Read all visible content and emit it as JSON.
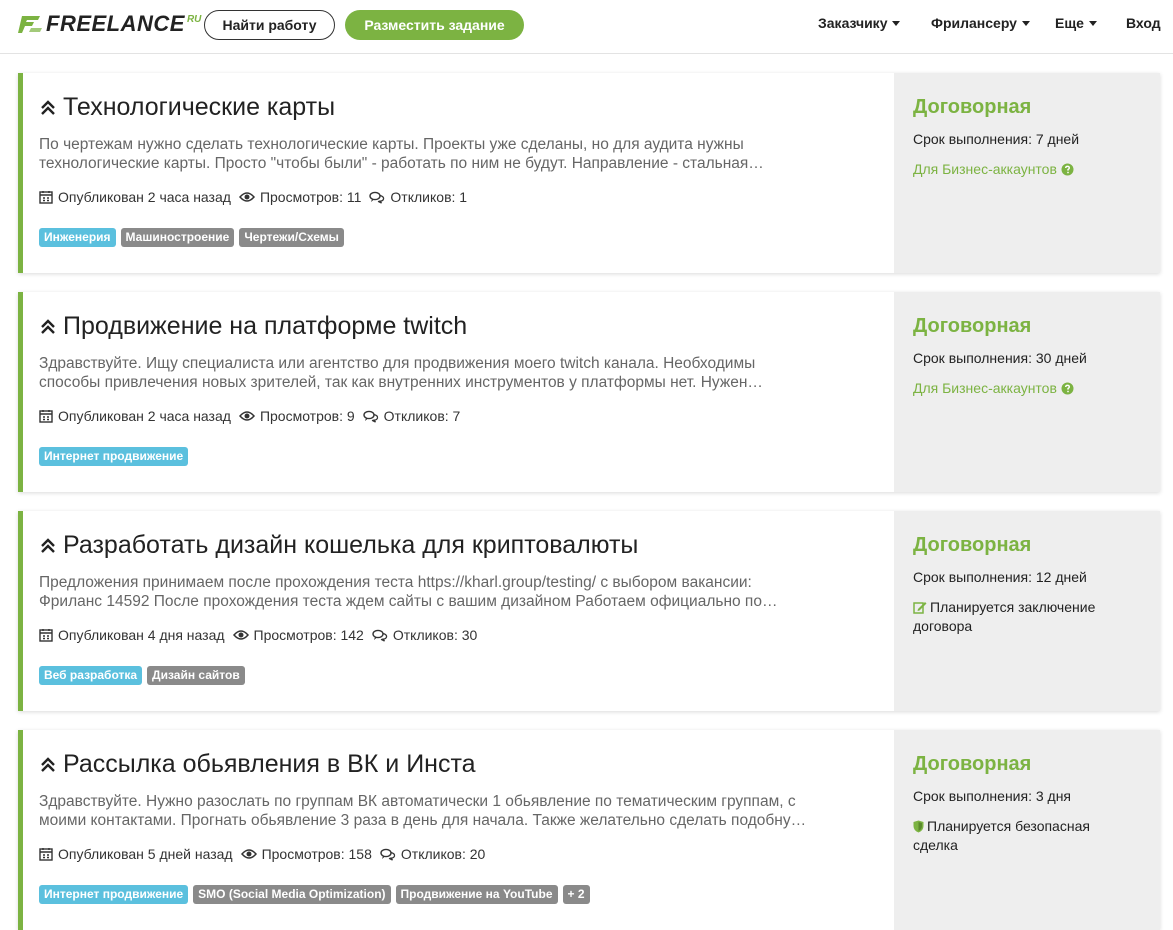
{
  "header": {
    "logo_text": "FREELANCE",
    "logo_ru": "RU",
    "find_work": "Найти работу",
    "post_task": "Разместить задание",
    "nav": [
      {
        "label": "Заказчику"
      },
      {
        "label": "Фрилансеру"
      },
      {
        "label": "Еще"
      },
      {
        "label": "Вход"
      }
    ]
  },
  "colors": {
    "brand": "#7cb342",
    "tag_blue": "#5bc0de",
    "tag_gray": "#8a8a8a"
  },
  "cards": [
    {
      "title": "Технологические карты",
      "desc1": "По чертежам нужно сделать технологические карты. Проекты уже сделаны, но для аудита нужны",
      "desc2": "технологические карты. Просто \"чтобы были\" - работать по ним не будут. Направление - стальная…",
      "published": "Опубликован 2 часа назад",
      "views": "Просмотров: 11",
      "replies": "Откликов: 1",
      "tags": [
        {
          "label": "Инженерия",
          "color": "blue"
        },
        {
          "label": "Машиностроение",
          "color": "gray"
        },
        {
          "label": "Чертежи/Схемы",
          "color": "gray"
        }
      ],
      "price": "Договорная",
      "deadline": "Срок выполнения: 7 дней",
      "biz": "Для Бизнес-аккаунтов"
    },
    {
      "title": "Продвижение на платформе twitch",
      "desc1": "Здравствуйте. Ищу специалиста или агентство для продвижения моего twitch канала. Необходимы",
      "desc2": "способы привлечения новых зрителей, так как внутренних инструментов у платформы нет. Нужен…",
      "published": "Опубликован 2 часа назад",
      "views": "Просмотров: 9",
      "replies": "Откликов: 7",
      "tags": [
        {
          "label": "Интернет продвижение",
          "color": "blue"
        }
      ],
      "price": "Договорная",
      "deadline": "Срок выполнения: 30 дней",
      "biz": "Для Бизнес-аккаунтов"
    },
    {
      "title": "Разработать дизайн кошелька для криптовалюты",
      "desc1": "Предложения принимаем после прохождения теста https://kharl.group/testing/ с выбором вакансии:",
      "desc2": "Фриланс 14592 После прохождения теста ждем сайты с вашим дизайном Работаем официально по…",
      "published": "Опубликован 4 дня назад",
      "views": "Просмотров: 142",
      "replies": "Откликов: 30",
      "tags": [
        {
          "label": "Веб разработка",
          "color": "blue"
        },
        {
          "label": "Дизайн сайтов",
          "color": "gray"
        }
      ],
      "price": "Договорная",
      "deadline": "Срок выполнения: 12 дней",
      "note": "Планируется заключение договора",
      "note_icon": "edit-icon"
    },
    {
      "title": "Рассылка обьявления в ВК и Инста",
      "desc1": "Здравствуйте. Нужно разослать по группам ВК автоматически 1 обьявление по тематическим группам, с",
      "desc2": "моими контактами. Прогнать обьявление 3 раза в день для начала. Также желательно сделать подобну…",
      "published": "Опубликован 5 дней назад",
      "views": "Просмотров: 158",
      "replies": "Откликов: 20",
      "tags": [
        {
          "label": "Интернет продвижение",
          "color": "blue"
        },
        {
          "label": "SMO (Social Media Optimization)",
          "color": "gray"
        },
        {
          "label": "Продвижение на YouTube",
          "color": "gray"
        },
        {
          "label": "+ 2",
          "color": "gray"
        }
      ],
      "price": "Договорная",
      "deadline": "Срок выполнения: 3 дня",
      "note": "Планируется безопасная сделка",
      "note_icon": "shield-icon"
    }
  ]
}
